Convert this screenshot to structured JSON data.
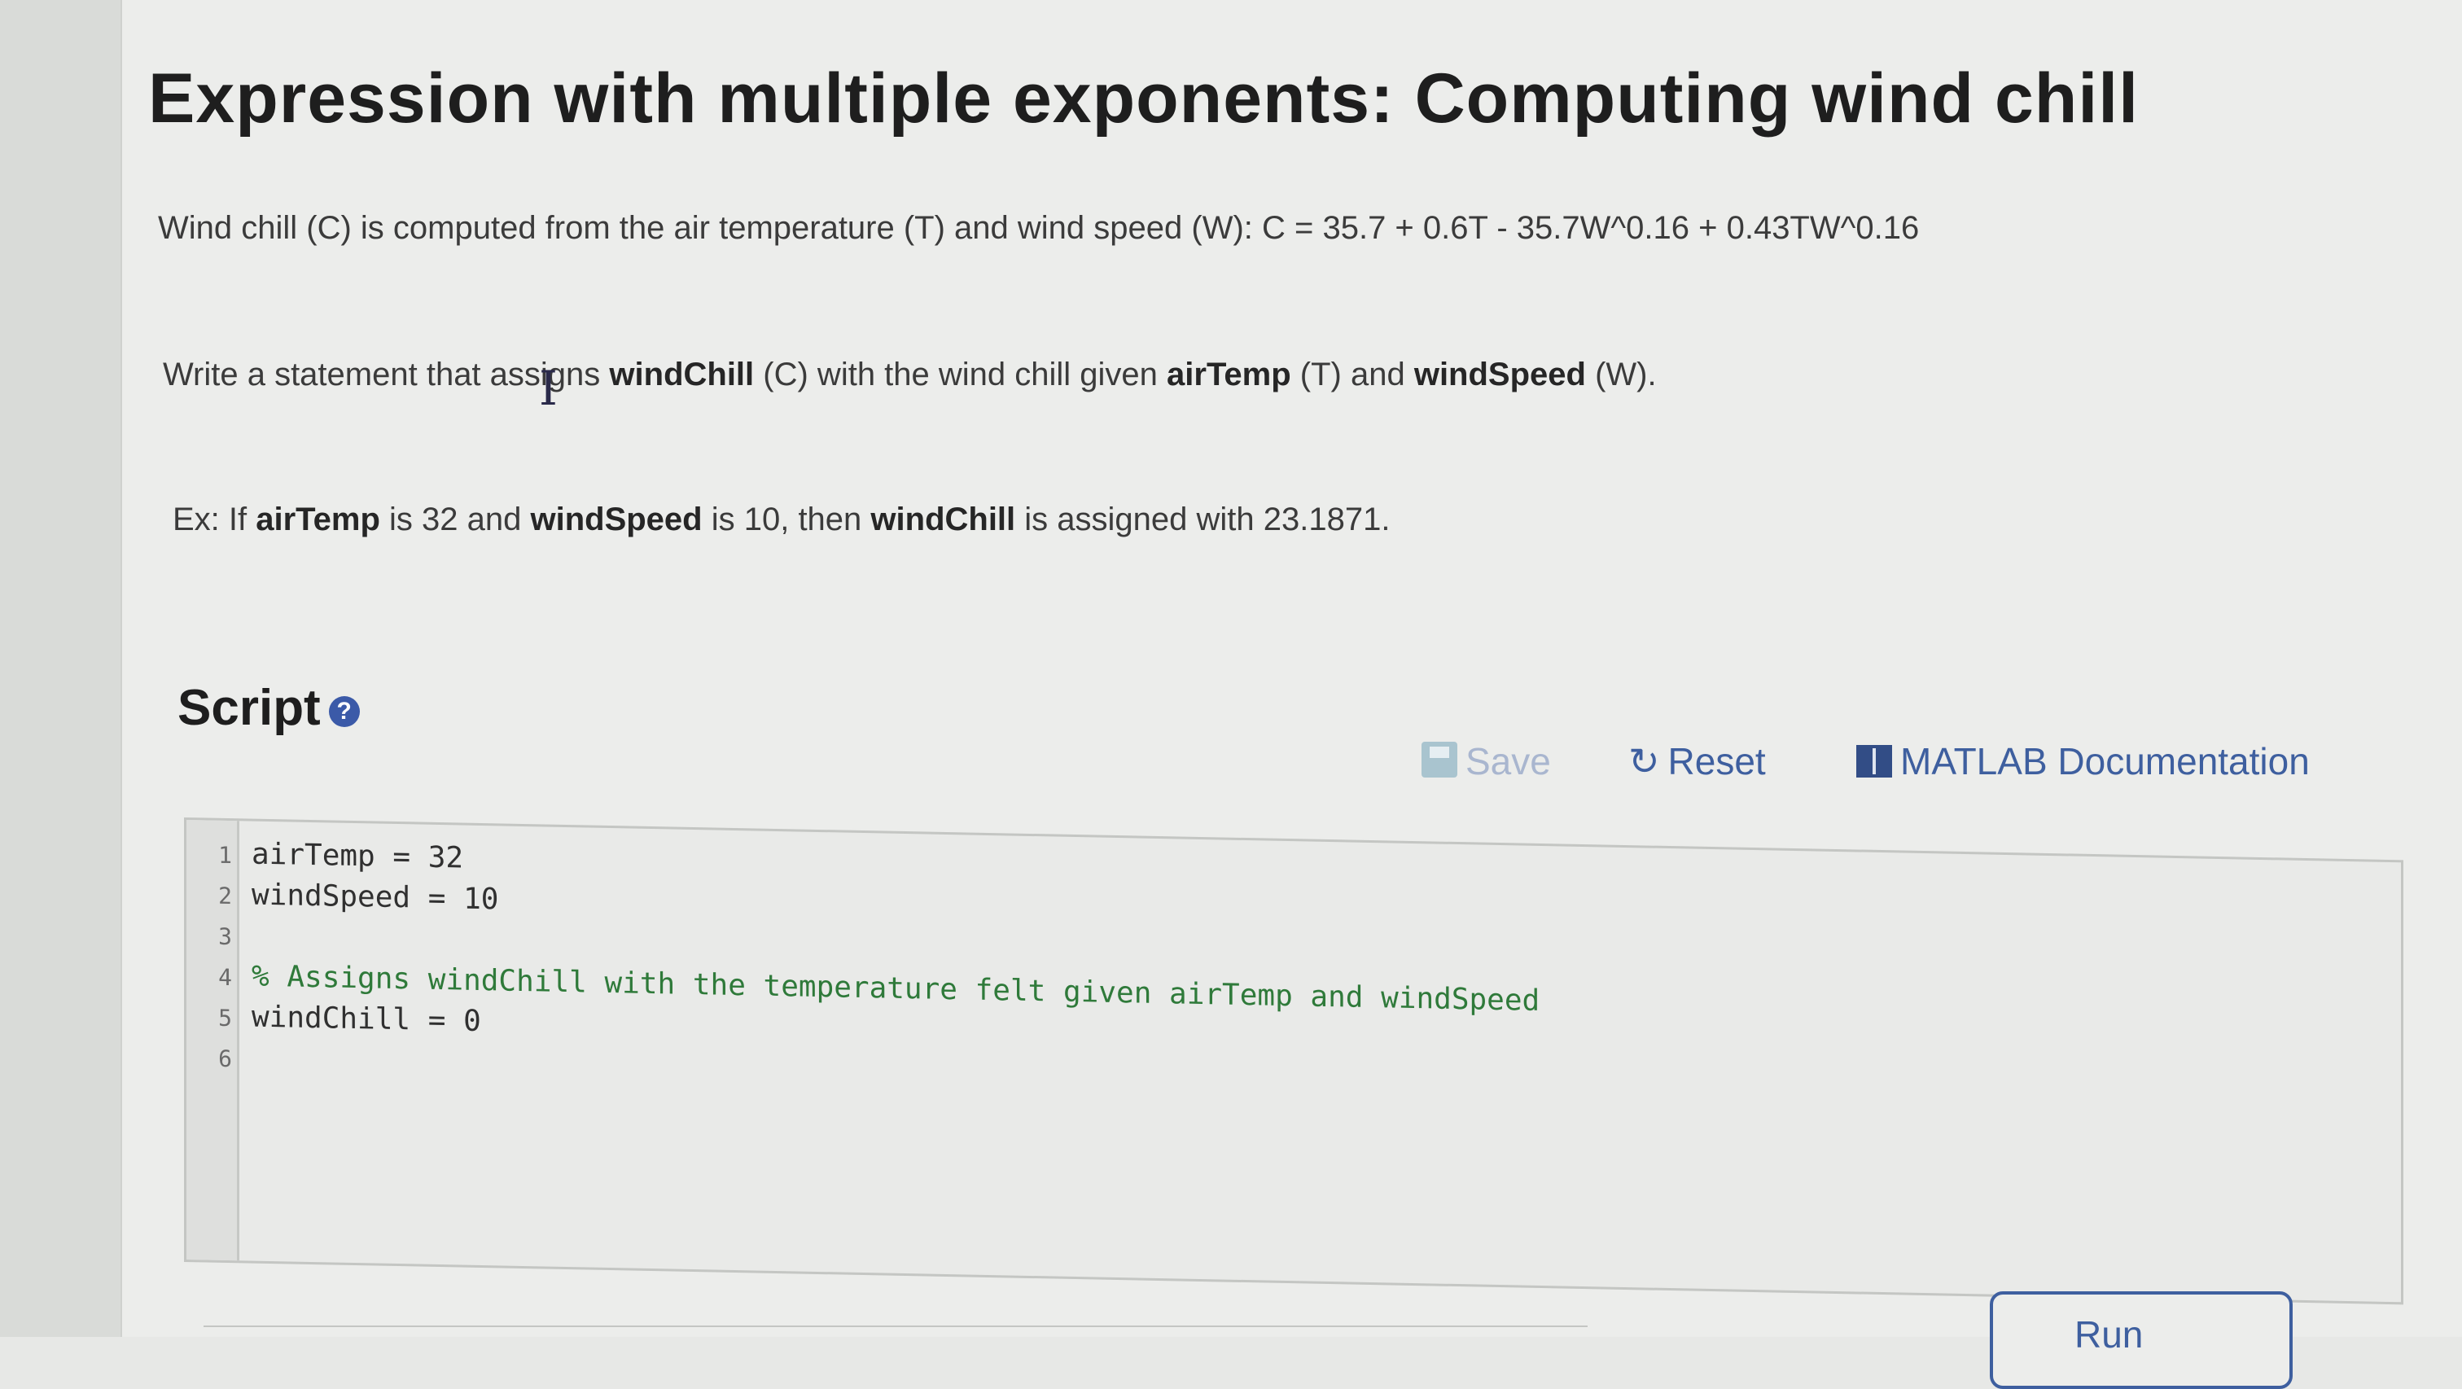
{
  "title": "Expression with multiple exponents: Computing wind chill",
  "intro": "Wind chill (C) is computed from the air temperature (T) and wind speed (W): C = 35.7 + 0.6T - 35.7W^0.16 + 0.43TW^0.16",
  "instruction": {
    "prefix": "Write a statement that assigns ",
    "var_result": "windChill",
    "mid1": " (C) with the wind chill given ",
    "var_temp": "airTemp",
    "mid2": " (T) and ",
    "var_speed": "windSpeed",
    "suffix": " (W)."
  },
  "example": {
    "prefix": "Ex: If ",
    "var_temp": "airTemp",
    "mid1": " is 32 and ",
    "var_speed": "windSpeed",
    "mid2": " is 10, then ",
    "var_result": "windChill",
    "suffix": " is assigned with 23.1871."
  },
  "script": {
    "heading": "Script",
    "help_icon": "question-circle-icon",
    "help_glyph": "?"
  },
  "toolbar": {
    "save_label": "Save",
    "save_icon": "save-icon",
    "reset_label": "Reset",
    "reset_icon": "refresh-icon",
    "reset_glyph": "↻",
    "docs_label": "MATLAB Documentation",
    "docs_icon": "book-icon"
  },
  "editor": {
    "lines": [
      {
        "number": "1",
        "text": "airTemp = 32",
        "type": "code"
      },
      {
        "number": "2",
        "text": "windSpeed = 10",
        "type": "code"
      },
      {
        "number": "3",
        "text": "",
        "type": "code"
      },
      {
        "number": "4",
        "text": "% Assigns windChill with the temperature felt given airTemp and windSpeed",
        "type": "comment"
      },
      {
        "number": "5",
        "text": "windChill = 0",
        "type": "code"
      },
      {
        "number": "6",
        "text": "",
        "type": "code"
      }
    ]
  },
  "run_button": {
    "label": "Run",
    "icon": "play-icon"
  },
  "colors": {
    "link": "#3e5f9f",
    "disabled": "#a9b6cf",
    "comment": "#2f7a3a"
  }
}
